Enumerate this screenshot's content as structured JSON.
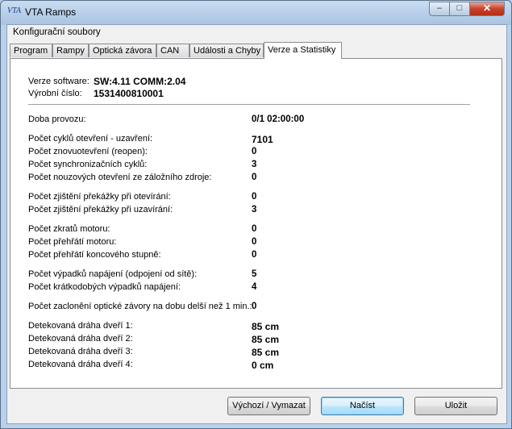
{
  "window": {
    "title": "VTA Ramps",
    "icon_text": "VTA",
    "controls": {
      "minimize": "–",
      "maximize": "□",
      "close": "✕"
    }
  },
  "menu": {
    "items": [
      "Konfigurační soubory"
    ]
  },
  "tabs": [
    {
      "label": "Program"
    },
    {
      "label": "Rampy"
    },
    {
      "label": "Optická závora"
    },
    {
      "label": "CAN"
    },
    {
      "label": "Události a Chyby"
    },
    {
      "label": "Verze a Statistiky",
      "active": true
    }
  ],
  "info": {
    "software_label": "Verze software:",
    "software_value": "SW:4.11 COMM:2.04",
    "serial_label": "Výrobní číslo:",
    "serial_value": "1531400810001"
  },
  "stats": [
    {
      "label": "Doba provozu:",
      "value": "0/1 02:00:00"
    },
    {
      "label": "Počet cyklů otevření - uzavření:",
      "value": "7101"
    },
    {
      "label": "Počet znovuotevření (reopen):",
      "value": "0"
    },
    {
      "label": "Počet synchronizačních cyklů:",
      "value": "3"
    },
    {
      "label": "Počet nouzových otevření ze záložního zdroje:",
      "value": "0"
    },
    {
      "label": "Počet zjištění překážky při otevírání:",
      "value": "0"
    },
    {
      "label": "Počet zjištění překážky při uzavírání:",
      "value": "3"
    },
    {
      "label": "Počet zkratů motoru:",
      "value": "0"
    },
    {
      "label": "Počet přehřátí motoru:",
      "value": "0"
    },
    {
      "label": "Počet přehřátí koncového stupně:",
      "value": "0"
    },
    {
      "label": "Počet výpadků napájení (odpojení od sítě):",
      "value": "5"
    },
    {
      "label": "Počet krátkodobých výpadků napájení:",
      "value": "4"
    },
    {
      "label": "Počet zaclonění optické závory na dobu delší než 1 min.:",
      "value": "0"
    },
    {
      "label": "Detekovaná dráha dveří 1:",
      "value": "85 cm"
    },
    {
      "label": "Detekovaná dráha dveří 2:",
      "value": "85 cm"
    },
    {
      "label": "Detekovaná dráha dveří 3:",
      "value": "85 cm"
    },
    {
      "label": "Detekovaná dráha dveří 4:",
      "value": "0 cm"
    }
  ],
  "buttons": {
    "reset": "Výchozí / Vymazat",
    "load": "Načíst",
    "save": "Uložit"
  },
  "colors": {
    "title_accent": "#1a3a8a",
    "close_button": "#c7412a",
    "default_button_border": "#3c7fb1"
  }
}
